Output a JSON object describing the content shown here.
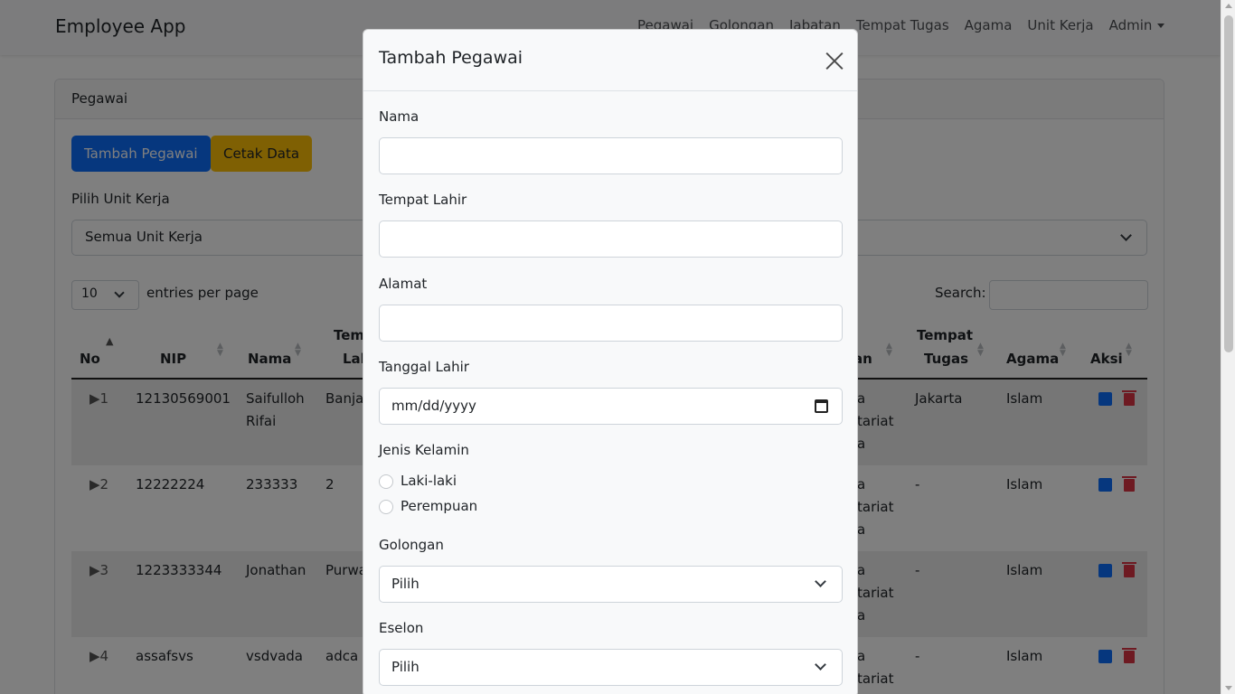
{
  "navbar": {
    "brand": "Employee App",
    "items": [
      "Pegawai",
      "Golongan",
      "Jabatan",
      "Tempat Tugas",
      "Agama",
      "Unit Kerja",
      "Admin"
    ]
  },
  "card": {
    "header": "Pegawai",
    "add_button": "Tambah Pegawai",
    "print_button": "Cetak Data",
    "unit_label": "Pilih Unit Kerja",
    "unit_selected": "Semua Unit Kerja",
    "entries_value": "10",
    "entries_label": "entries per page",
    "search_label": "Search:"
  },
  "table": {
    "headers": {
      "no": "No",
      "nip": "NIP",
      "nama": "Nama",
      "tempat_lahir_1": "Tem",
      "tempat_lahir_2": "Lah",
      "jabatan_partial": "an",
      "tempat_tugas_1": "Tempat",
      "tempat_tugas_2": "Tugas",
      "agama": "Agama",
      "aksi": "Aksi"
    },
    "rows": [
      {
        "no": "▶1",
        "nip": "12130569001",
        "nama_1": "Saifulloh",
        "nama_2": "Rifai",
        "tempat": "Banja",
        "unit_1": "a",
        "unit_2": "tariat",
        "unit_3": "a",
        "tugas": "Jakarta",
        "agama": "Islam"
      },
      {
        "no": "▶2",
        "nip": "12222224",
        "nama_1": "233333",
        "nama_2": "",
        "tempat": "2",
        "unit_1": "a",
        "unit_2": "tariat",
        "unit_3": "a",
        "tugas": "-",
        "agama": "Islam"
      },
      {
        "no": "▶3",
        "nip": "1223333344",
        "nama_1": "Jonathan",
        "nama_2": "",
        "tempat": "Purwa",
        "unit_1": "a",
        "unit_2": "tariat",
        "unit_3": "a",
        "tugas": "-",
        "agama": "Islam"
      },
      {
        "no": "▶4",
        "nip": "assafsvs",
        "nama_1": "vsdvada",
        "nama_2": "",
        "tempat": "adca",
        "unit_1": "a",
        "unit_2": "tariat",
        "unit_3": "",
        "tugas": "-",
        "agama": "Islam"
      }
    ]
  },
  "modal": {
    "title": "Tambah Pegawai",
    "nama_label": "Nama",
    "tempat_lahir_label": "Tempat Lahir",
    "alamat_label": "Alamat",
    "tanggal_lahir_label": "Tanggal Lahir",
    "tanggal_placeholder": "mm/dd/yyyy",
    "jenis_kelamin_label": "Jenis Kelamin",
    "gender_options": [
      "Laki-laki",
      "Perempuan"
    ],
    "golongan_label": "Golongan",
    "golongan_selected": "Pilih",
    "eselon_label": "Eselon",
    "eselon_selected": "Pilih"
  },
  "colors": {
    "primary": "#0d6efd",
    "warning": "#ffc107",
    "danger": "#dc3545"
  }
}
